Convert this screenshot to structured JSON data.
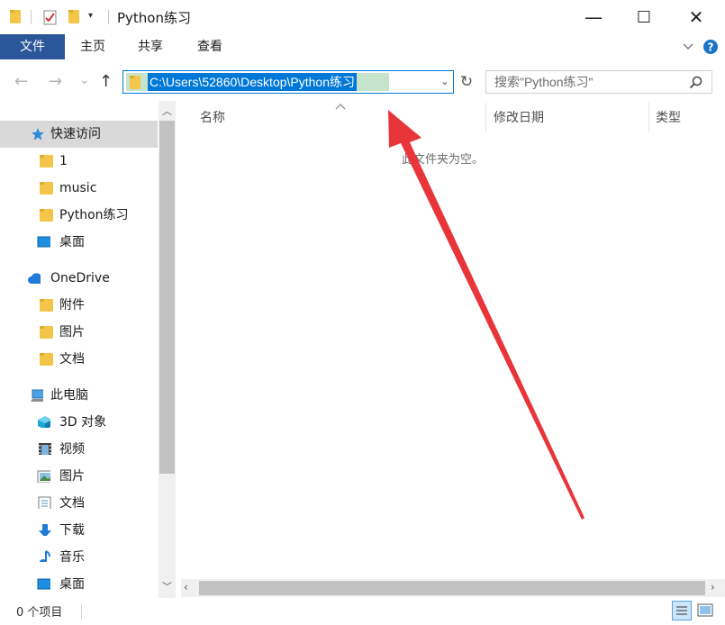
{
  "window": {
    "title": "Python练习",
    "controls": {
      "minimize": "—",
      "maximize": "☐",
      "close": "✕"
    }
  },
  "ribbon": {
    "tabs": [
      {
        "label": "文件",
        "active": true
      },
      {
        "label": "主页"
      },
      {
        "label": "共享"
      },
      {
        "label": "查看"
      }
    ]
  },
  "navigation": {
    "back": "←",
    "forward": "→",
    "recent": "⌄",
    "up": "↑",
    "address": "C:\\Users\\52860\\Desktop\\Python练习",
    "refresh": "↻"
  },
  "search": {
    "placeholder": "搜索\"Python练习\""
  },
  "sidebar": {
    "quick_access": {
      "label": "快速访问",
      "items": [
        "1",
        "music",
        "Python练习",
        "桌面"
      ]
    },
    "onedrive": {
      "label": "OneDrive",
      "items": [
        "附件",
        "图片",
        "文档"
      ]
    },
    "this_pc": {
      "label": "此电脑",
      "items": [
        "3D 对象",
        "视频",
        "图片",
        "文档",
        "下载",
        "音乐",
        "桌面"
      ]
    }
  },
  "columns": {
    "name": "名称",
    "modified": "修改日期",
    "type": "类型"
  },
  "content": {
    "empty_message": "此文件夹为空。"
  },
  "status": {
    "item_count": "0 个项目"
  },
  "colors": {
    "accent": "#0078d7",
    "file_tab": "#2b579a",
    "arrow": "#e8353a",
    "selected_nav": "#d9d9d9"
  }
}
